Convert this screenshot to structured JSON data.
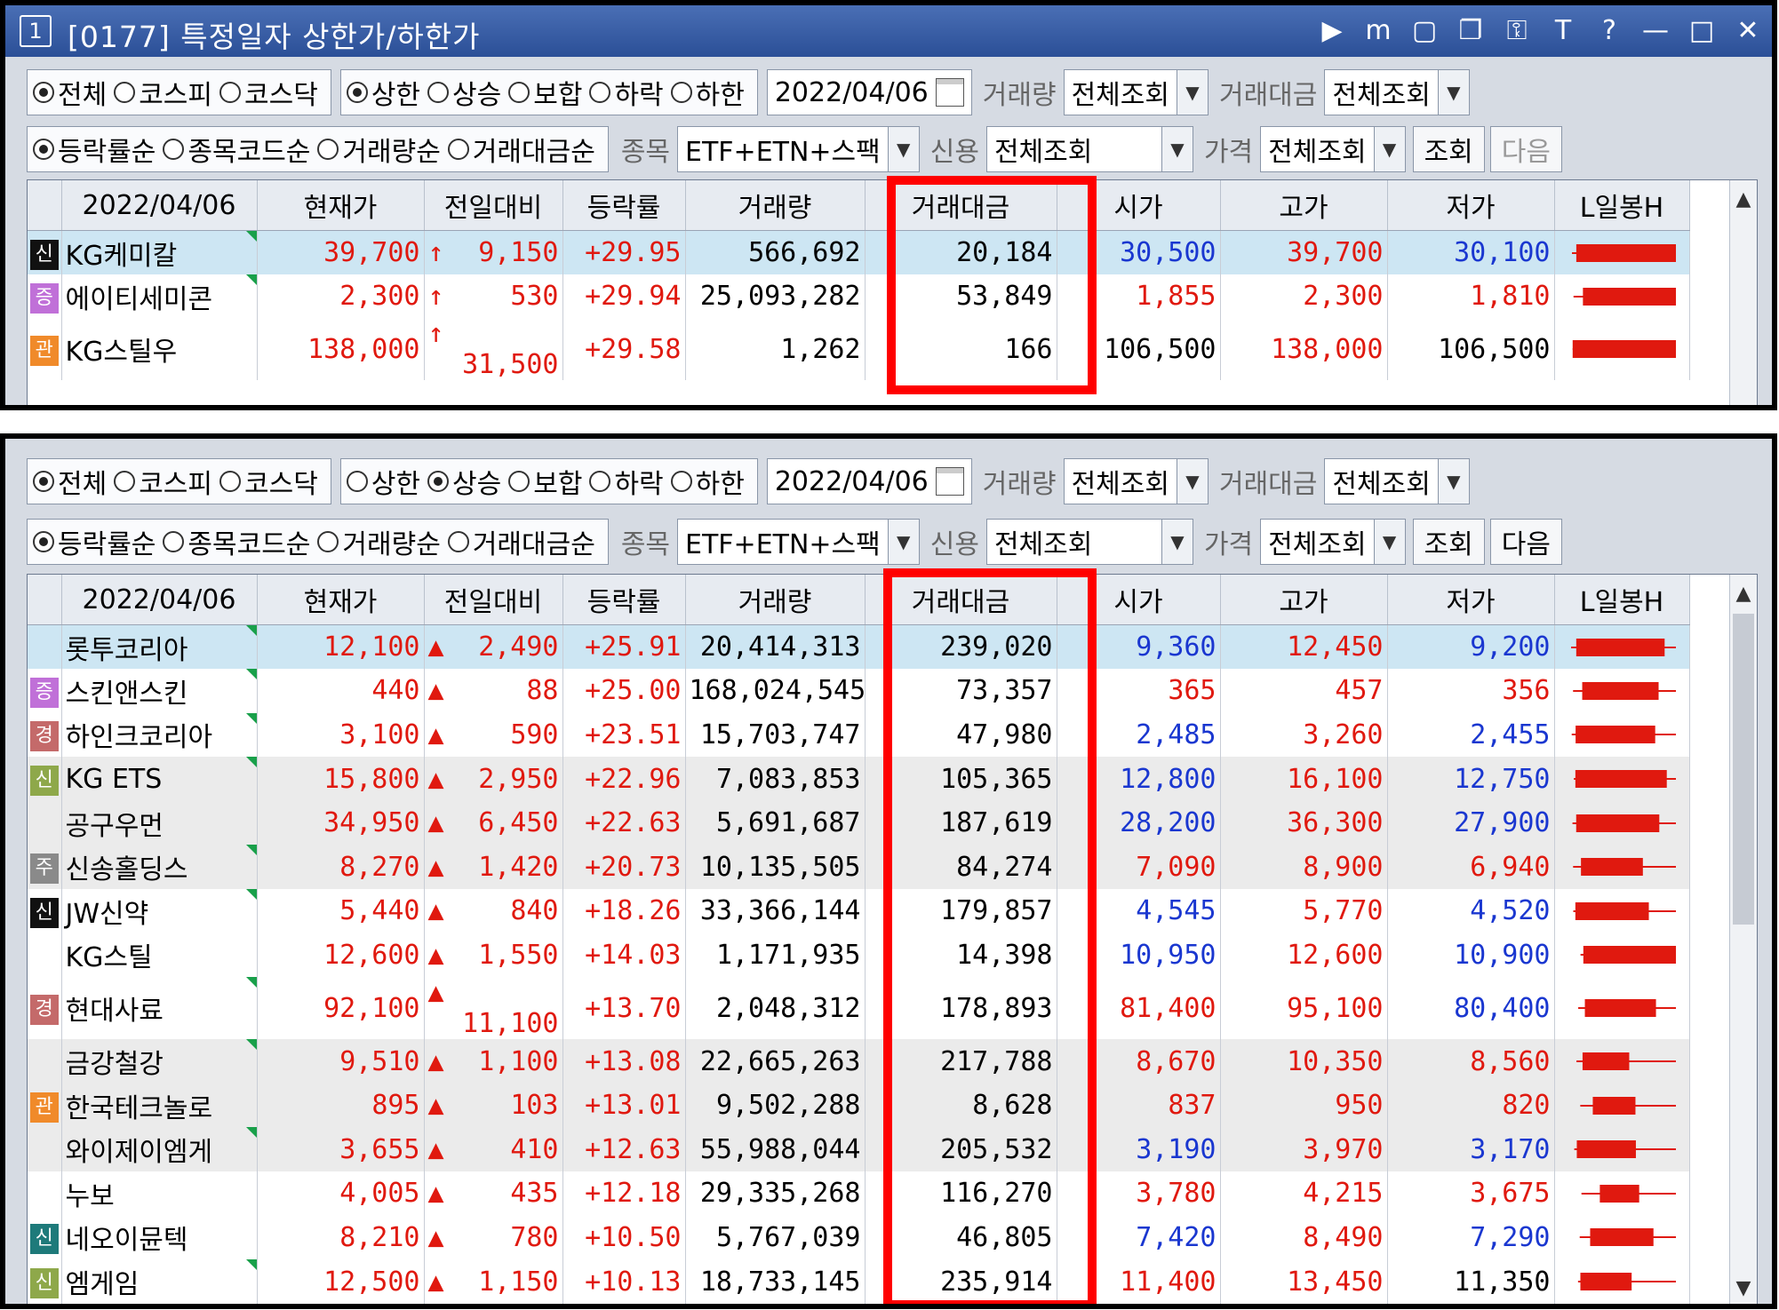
{
  "window": {
    "number": "1",
    "title": "[0177] 특정일자 상한가/하한가",
    "icons": [
      "play-icon",
      "memo-icon",
      "layout-icon",
      "window-icon",
      "lock-icon",
      "text-icon",
      "help-icon",
      "minimize-icon",
      "maximize-icon",
      "close-icon"
    ],
    "icon_glyphs": [
      "▶",
      "m",
      "▢",
      "❐",
      "⚿",
      "T",
      "?",
      "—",
      "□",
      "✕"
    ]
  },
  "panel1": {
    "market": {
      "options": [
        "전체",
        "코스피",
        "코스닥"
      ],
      "selected": 0
    },
    "limit": {
      "options": [
        "상한",
        "상승",
        "보합",
        "하락",
        "하한"
      ],
      "selected": 0
    },
    "date": "2022/04/06",
    "volume_label": "거래량",
    "volume_value": "전체조회",
    "amount_label": "거래대금",
    "amount_value": "전체조회",
    "sort": {
      "options": [
        "등락률순",
        "종목코드순",
        "거래량순",
        "거래대금순"
      ],
      "selected": 0
    },
    "item_label": "종목",
    "item_value": "ETF+ETN+스팩",
    "credit_label": "신용",
    "credit_value": "전체조회",
    "price_label": "가격",
    "price_value": "전체조회",
    "search_button": "조회",
    "next_button": "다음",
    "next_enabled": false,
    "columns": [
      "2022/04/06",
      "현재가",
      "전일대비",
      "등락률",
      "거래량",
      "거래대금",
      "시가",
      "고가",
      "저가",
      "L일봉H"
    ],
    "rows": [
      {
        "badge": "신",
        "badge_color": "#111111",
        "name": "KG케미칼",
        "price": "39,700",
        "arrow": "↑",
        "change": "9,150",
        "rate": "+29.95",
        "volume": "566,692",
        "amount": "20,184",
        "open": "30,500",
        "open_c": "down",
        "high": "39,700",
        "high_c": "up",
        "low": "30,100",
        "low_c": "down",
        "hl": true,
        "gray": false,
        "tri": true
      },
      {
        "badge": "증",
        "badge_color": "#c070d8",
        "name": "에이티세미콘",
        "price": "2,300",
        "arrow": "↑",
        "change": "530",
        "rate": "+29.94",
        "volume": "25,093,282",
        "amount": "53,849",
        "open": "1,855",
        "open_c": "up",
        "high": "2,300",
        "high_c": "up",
        "low": "1,810",
        "low_c": "up",
        "hl": false,
        "gray": false,
        "tri": true
      },
      {
        "badge": "관",
        "badge_color": "#f08a2a",
        "name": "KG스틸우",
        "price": "138,000",
        "arrow": "↑",
        "change": "31,500",
        "rate": "+29.58",
        "volume": "1,262",
        "amount": "166",
        "open": "106,500",
        "open_c": "blk",
        "high": "138,000",
        "high_c": "up",
        "low": "106,500",
        "low_c": "blk",
        "hl": false,
        "gray": false,
        "tri": false
      }
    ]
  },
  "panel2": {
    "market": {
      "options": [
        "전체",
        "코스피",
        "코스닥"
      ],
      "selected": 0
    },
    "limit": {
      "options": [
        "상한",
        "상승",
        "보합",
        "하락",
        "하한"
      ],
      "selected": 1
    },
    "date": "2022/04/06",
    "volume_label": "거래량",
    "volume_value": "전체조회",
    "amount_label": "거래대금",
    "amount_value": "전체조회",
    "sort": {
      "options": [
        "등락률순",
        "종목코드순",
        "거래량순",
        "거래대금순"
      ],
      "selected": 0
    },
    "item_label": "종목",
    "item_value": "ETF+ETN+스팩",
    "credit_label": "신용",
    "credit_value": "전체조회",
    "price_label": "가격",
    "price_value": "전체조회",
    "search_button": "조회",
    "next_button": "다음",
    "next_enabled": true,
    "columns": [
      "2022/04/06",
      "현재가",
      "전일대비",
      "등락률",
      "거래량",
      "거래대금",
      "시가",
      "고가",
      "저가",
      "L일봉H"
    ],
    "rows": [
      {
        "badge": "",
        "badge_color": "",
        "name": "롯투코리아",
        "price": "12,100",
        "arrow": "▲",
        "change": "2,490",
        "rate": "+25.91",
        "volume": "20,414,313",
        "amount": "239,020",
        "open": "9,360",
        "open_c": "down",
        "high": "12,450",
        "high_c": "up",
        "low": "9,200",
        "low_c": "down",
        "hl": true,
        "gray": false,
        "tri": true
      },
      {
        "badge": "증",
        "badge_color": "#c070d8",
        "name": "스킨앤스킨",
        "price": "440",
        "arrow": "▲",
        "change": "88",
        "rate": "+25.00",
        "volume": "168,024,545",
        "amount": "73,357",
        "open": "365",
        "open_c": "up",
        "high": "457",
        "high_c": "up",
        "low": "356",
        "low_c": "up",
        "hl": false,
        "gray": false,
        "tri": true
      },
      {
        "badge": "경",
        "badge_color": "#c46a6a",
        "name": "하인크코리아",
        "price": "3,100",
        "arrow": "▲",
        "change": "590",
        "rate": "+23.51",
        "volume": "15,703,747",
        "amount": "47,980",
        "open": "2,485",
        "open_c": "down",
        "high": "3,260",
        "high_c": "up",
        "low": "2,455",
        "low_c": "down",
        "hl": false,
        "gray": false,
        "tri": true
      },
      {
        "badge": "신",
        "badge_color": "#8ea84a",
        "name": "KG ETS",
        "price": "15,800",
        "arrow": "▲",
        "change": "2,950",
        "rate": "+22.96",
        "volume": "7,083,853",
        "amount": "105,365",
        "open": "12,800",
        "open_c": "down",
        "high": "16,100",
        "high_c": "up",
        "low": "12,750",
        "low_c": "down",
        "hl": false,
        "gray": true,
        "tri": true
      },
      {
        "badge": "",
        "badge_color": "",
        "name": "공구우먼",
        "price": "34,950",
        "arrow": "▲",
        "change": "6,450",
        "rate": "+22.63",
        "volume": "5,691,687",
        "amount": "187,619",
        "open": "28,200",
        "open_c": "down",
        "high": "36,300",
        "high_c": "up",
        "low": "27,900",
        "low_c": "down",
        "hl": false,
        "gray": true,
        "tri": false
      },
      {
        "badge": "주",
        "badge_color": "#8a8a8a",
        "name": "신송홀딩스",
        "price": "8,270",
        "arrow": "▲",
        "change": "1,420",
        "rate": "+20.73",
        "volume": "10,135,505",
        "amount": "84,274",
        "open": "7,090",
        "open_c": "up",
        "high": "8,900",
        "high_c": "up",
        "low": "6,940",
        "low_c": "up",
        "hl": false,
        "gray": true,
        "tri": true
      },
      {
        "badge": "신",
        "badge_color": "#111111",
        "name": "JW신약",
        "price": "5,440",
        "arrow": "▲",
        "change": "840",
        "rate": "+18.26",
        "volume": "33,366,144",
        "amount": "179,857",
        "open": "4,545",
        "open_c": "down",
        "high": "5,770",
        "high_c": "up",
        "low": "4,520",
        "low_c": "down",
        "hl": false,
        "gray": false,
        "tri": true
      },
      {
        "badge": "",
        "badge_color": "",
        "name": "KG스틸",
        "price": "12,600",
        "arrow": "▲",
        "change": "1,550",
        "rate": "+14.03",
        "volume": "1,171,935",
        "amount": "14,398",
        "open": "10,950",
        "open_c": "down",
        "high": "12,600",
        "high_c": "up",
        "low": "10,900",
        "low_c": "down",
        "hl": false,
        "gray": false,
        "tri": false
      },
      {
        "badge": "경",
        "badge_color": "#c46a6a",
        "name": "현대사료",
        "price": "92,100",
        "arrow": "▲",
        "change": "11,100",
        "rate": "+13.70",
        "volume": "2,048,312",
        "amount": "178,893",
        "open": "81,400",
        "open_c": "up",
        "high": "95,100",
        "high_c": "up",
        "low": "80,400",
        "low_c": "down",
        "hl": false,
        "gray": false,
        "tri": true
      },
      {
        "badge": "",
        "badge_color": "",
        "name": "금강철강",
        "price": "9,510",
        "arrow": "▲",
        "change": "1,100",
        "rate": "+13.08",
        "volume": "22,665,263",
        "amount": "217,788",
        "open": "8,670",
        "open_c": "up",
        "high": "10,350",
        "high_c": "up",
        "low": "8,560",
        "low_c": "up",
        "hl": false,
        "gray": true,
        "tri": true
      },
      {
        "badge": "관",
        "badge_color": "#f08a2a",
        "name": "한국테크놀로",
        "price": "895",
        "arrow": "▲",
        "change": "103",
        "rate": "+13.01",
        "volume": "9,502,288",
        "amount": "8,628",
        "open": "837",
        "open_c": "up",
        "high": "950",
        "high_c": "up",
        "low": "820",
        "low_c": "up",
        "hl": false,
        "gray": true,
        "tri": false
      },
      {
        "badge": "",
        "badge_color": "",
        "name": "와이제이엠게",
        "price": "3,655",
        "arrow": "▲",
        "change": "410",
        "rate": "+12.63",
        "volume": "55,988,044",
        "amount": "205,532",
        "open": "3,190",
        "open_c": "down",
        "high": "3,970",
        "high_c": "up",
        "low": "3,170",
        "low_c": "down",
        "hl": false,
        "gray": true,
        "tri": true
      },
      {
        "badge": "",
        "badge_color": "",
        "name": "누보",
        "price": "4,005",
        "arrow": "▲",
        "change": "435",
        "rate": "+12.18",
        "volume": "29,335,268",
        "amount": "116,270",
        "open": "3,780",
        "open_c": "up",
        "high": "4,215",
        "high_c": "up",
        "low": "3,675",
        "low_c": "up",
        "hl": false,
        "gray": false,
        "tri": false
      },
      {
        "badge": "신",
        "badge_color": "#1e7a7a",
        "name": "네오이뮨텍",
        "price": "8,210",
        "arrow": "▲",
        "change": "780",
        "rate": "+10.50",
        "volume": "5,767,039",
        "amount": "46,805",
        "open": "7,420",
        "open_c": "down",
        "high": "8,490",
        "high_c": "up",
        "low": "7,290",
        "low_c": "down",
        "hl": false,
        "gray": false,
        "tri": false
      },
      {
        "badge": "신",
        "badge_color": "#8ea84a",
        "name": "엠게임",
        "price": "12,500",
        "arrow": "▲",
        "change": "1,150",
        "rate": "+10.13",
        "volume": "18,733,145",
        "amount": "235,914",
        "open": "11,400",
        "open_c": "up",
        "high": "13,450",
        "high_c": "up",
        "low": "11,350",
        "low_c": "blk",
        "hl": false,
        "gray": false,
        "tri": true
      }
    ]
  },
  "colors": {
    "up": "#e0190f",
    "down": "#1a37d0",
    "highlight": "#ff0000",
    "selected_row": "#cde6f3"
  }
}
